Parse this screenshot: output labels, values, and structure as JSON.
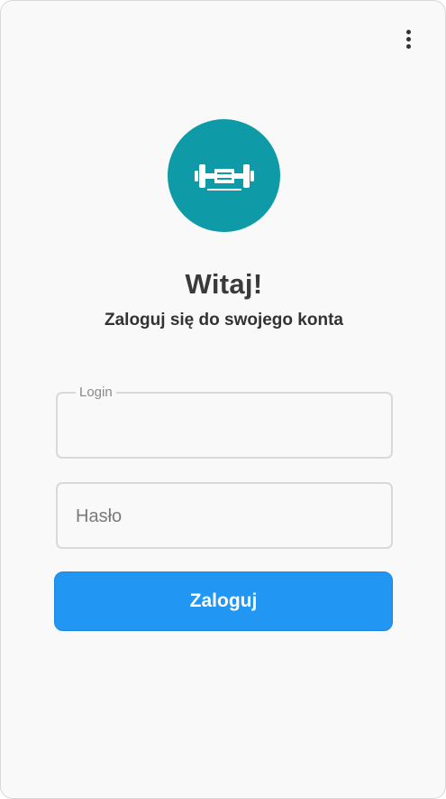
{
  "header": {
    "menu_icon": "more-vertical-icon"
  },
  "logo": {
    "icon": "dumbbell-icon",
    "background_color": "#0e9aa7"
  },
  "welcome": {
    "title": "Witaj!",
    "subtitle": "Zaloguj się do swojego konta"
  },
  "form": {
    "login": {
      "label": "Login",
      "value": ""
    },
    "password": {
      "placeholder": "Hasło",
      "value": ""
    },
    "submit_label": "Zaloguj",
    "submit_color": "#2196f3"
  }
}
